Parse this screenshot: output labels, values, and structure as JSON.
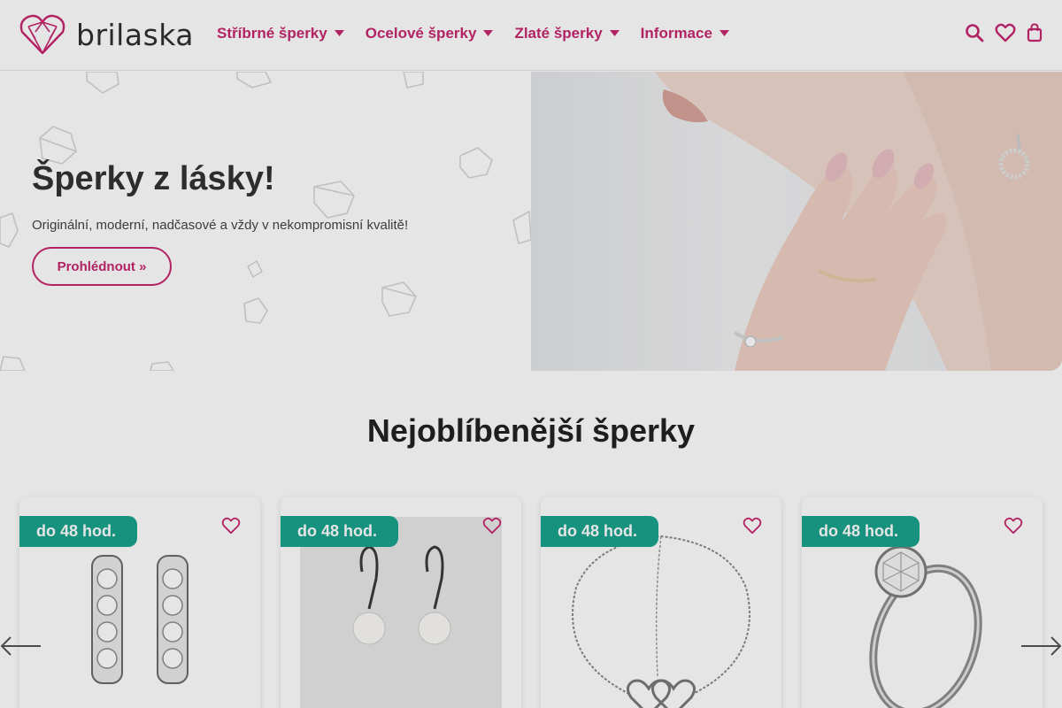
{
  "brand": {
    "name": "brilaska",
    "accent": "#c72770",
    "badge_color": "#1aa38e"
  },
  "nav": {
    "items": [
      {
        "label": "Stříbrné šperky"
      },
      {
        "label": "Ocelové šperky"
      },
      {
        "label": "Zlaté šperky"
      },
      {
        "label": "Informace"
      }
    ]
  },
  "header_icons": [
    "search-icon",
    "heart-icon",
    "shopping-bag-icon"
  ],
  "hero": {
    "title": "Šperky z lásky!",
    "subtitle": "Originální, moderní, nadčasové a vždy v nekompromisní kvalitě!",
    "button": "Prohlédnout »"
  },
  "section": {
    "title": "Nejoblíbenější šperky"
  },
  "products": [
    {
      "badge": "do 48 hod.",
      "image": "earrings-hoop-icon"
    },
    {
      "badge": "do 48 hod.",
      "image": "pearl-earrings-icon"
    },
    {
      "badge": "do 48 hod.",
      "image": "heart-bracelet-icon"
    },
    {
      "badge": "do 48 hod.",
      "image": "solitaire-ring-icon"
    }
  ]
}
